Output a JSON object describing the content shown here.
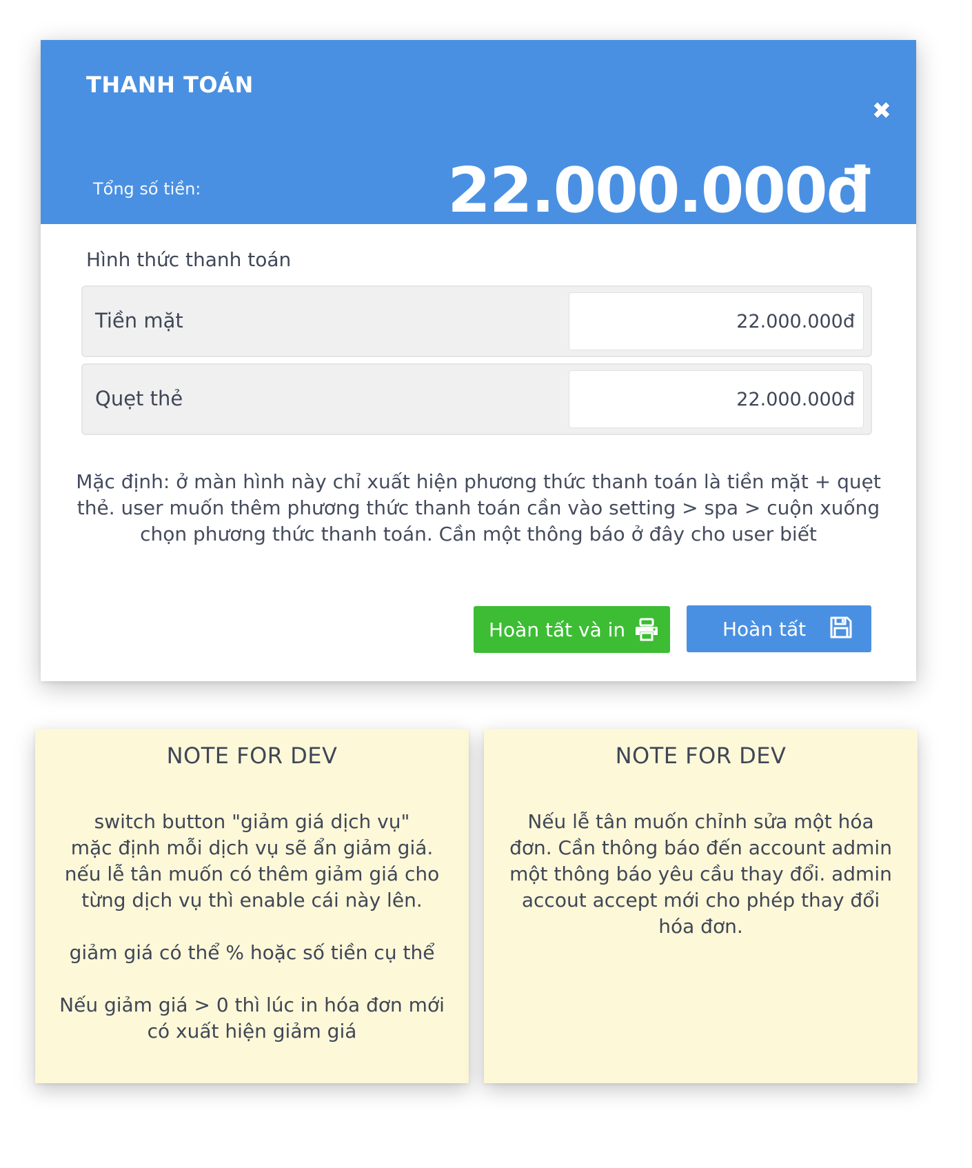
{
  "modal": {
    "title": "THANH TOÁN",
    "total_label": "Tổng số tiền:",
    "total_amount": "22.000.000đ",
    "close_icon": "close-icon",
    "section_title": "Hình thức thanh toán",
    "payment_methods": [
      {
        "label": "Tiền mặt",
        "value": "22.000.000đ"
      },
      {
        "label": "Quẹt thẻ",
        "value": "22.000.000đ"
      }
    ],
    "note": "Mặc định: ở màn hình này chỉ xuất hiện phương thức thanh toán là tiền mặt + quẹt thẻ. user muốn thêm phương thức thanh toán cần vào setting > spa > cuộn xuống chọn phương thức thanh toán. Cần một thông báo ở đây cho user biết",
    "buttons": {
      "print_label": "Hoàn tất và in",
      "print_icon": "printer-icon",
      "save_label": "Hoàn tất",
      "save_icon": "floppy-disk-icon"
    },
    "colors": {
      "header": "#4a90e2",
      "print_button": "#3cbd34",
      "save_button": "#4a90e2"
    }
  },
  "notes": [
    {
      "title": "NOTE FOR DEV",
      "body": "switch button \"giảm giá dịch vụ\"\nmặc định mỗi dịch vụ sẽ ẩn giảm giá.\nnếu lễ tân muốn có thêm giảm giá cho\ntừng dịch vụ thì enable cái này lên.\n\ngiảm giá có thể % hoặc số tiền cụ thể\n\nNếu giảm giá > 0 thì lúc in hóa đơn mới\ncó xuất hiện giảm giá"
    },
    {
      "title": "NOTE FOR DEV",
      "body": "Nếu lễ tân muốn chỉnh sửa một hóa\nđơn. Cần thông báo đến account admin\nmột thông báo yêu cầu thay đổi. admin\naccout accept mới cho phép thay đổi\nhóa đơn."
    }
  ],
  "note_color": "#fdf8d8"
}
